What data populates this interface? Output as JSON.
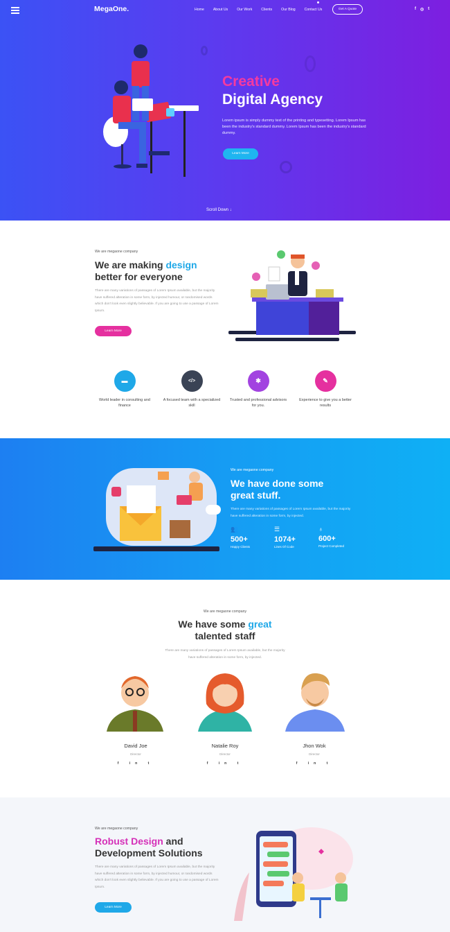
{
  "header": {
    "logo": "MegaOne.",
    "menu": [
      "Home",
      "About Us",
      "Our Work",
      "Clients",
      "Our Blog",
      "Contact Us"
    ],
    "cta": "Get A Quote",
    "social": [
      "f",
      "◎",
      "t"
    ]
  },
  "hero": {
    "title_line1": "Creative",
    "title_line2": "Digital Agency",
    "text": "Lorem ipsum is simply dummy text of the printing and typesetting. Lorem Ipsum has been the industry's standard dummy. Lorem Ipsum has been the industry's standard dummy.",
    "button": "Learn More",
    "scroll": "Scroll Down"
  },
  "about": {
    "tag": "We are megaone company",
    "title_a": "We are making ",
    "title_hl": "design",
    "title_b": "better for everyone",
    "text": "There are many variations of passages of Lorem Ipsum available, but the majority have suffered alteration in some form, by injected humour, or randomised words which don't look even slightly believable. If you are going to use a passage of Lorem Ipsum.",
    "button": "Learn More"
  },
  "features": [
    {
      "label": "World leader in consulting and finance",
      "icon": "folder-icon",
      "glyph": "▬",
      "color": "#1fa8e8"
    },
    {
      "label": "A focused team with a specialized skill",
      "icon": "code-icon",
      "glyph": "</>",
      "color": "#3a4355"
    },
    {
      "label": "Trusted and professional advisors for you.",
      "icon": "gear-icon",
      "glyph": "✱",
      "color": "#a243e0"
    },
    {
      "label": "Experience to give you a better results",
      "icon": "edit-icon",
      "glyph": "✎",
      "color": "#e5309f"
    }
  ],
  "work": {
    "tag": "We are megaone company",
    "title_1": "We have done some",
    "title_2": "great stuff.",
    "text": "There are many variations of passages of Lorem Ipsum available, but the majority have suffered alteration in some form, by injected.",
    "stats": [
      {
        "num": "500+",
        "label": "Happy Clients",
        "icon": "users-icon",
        "glyph": "👥"
      },
      {
        "num": "1074+",
        "label": "Lines Of Code",
        "icon": "list-icon",
        "glyph": "☰"
      },
      {
        "num": "600+",
        "label": "Project Completed",
        "icon": "award-icon",
        "glyph": "♁"
      }
    ]
  },
  "team": {
    "tag": "We are megaone company",
    "title_a": "We have some ",
    "title_hl": "great",
    "title_b": "talented staff",
    "text": "There are many variations of passages of Lorem Ipsum available, but the majority have suffered alteration in some form, by injected.",
    "members": [
      {
        "name": "David Joe",
        "role": "Director",
        "social": "f in t"
      },
      {
        "name": "Natalie Roy",
        "role": "Director",
        "social": "f in t"
      },
      {
        "name": "Jhon Wok",
        "role": "Director",
        "social": "f in t"
      }
    ]
  },
  "solutions": {
    "tag": "We are megaone company",
    "title_hl": "Robust Design",
    "title_a": " and",
    "title_b": "Development Solutions",
    "text": "There are many variations of passages of Lorem Ipsum available, but the majority have suffered alteration in some form, by injected humour, or randomised words which don't look even slightly believable. If you are going to use a passage of Lorem Ipsum.",
    "button": "Learn More"
  }
}
